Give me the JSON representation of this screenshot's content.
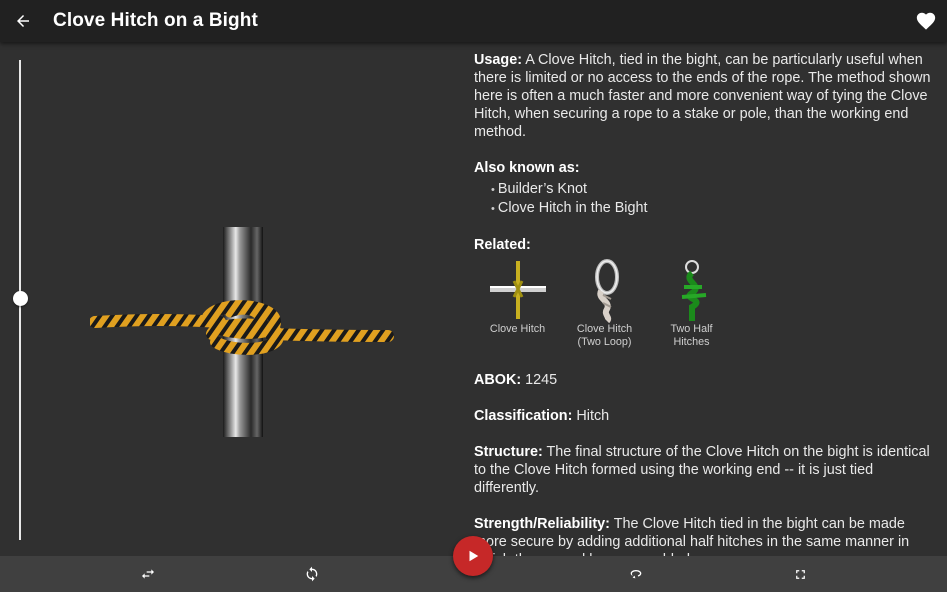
{
  "app_bar": {
    "title": "Clove Hitch on a Bight",
    "back_icon": "arrow-left-icon",
    "favorite_icon": "heart-icon"
  },
  "viewer": {
    "slider_position": 0.5,
    "rope_color": "#e0a020",
    "rope_pattern_color": "#1a1a1a"
  },
  "info": {
    "usage_label": "Usage:",
    "usage_text": "A Clove Hitch, tied in the bight, can be particularly useful when there is limited or no access to the ends of the rope. The method shown here is often a much faster and more convenient way of tying the Clove Hitch, when securing a rope to a stake or pole, than the working end method.",
    "aka_label": "Also known as:",
    "aka_items": [
      "Builder’s Knot",
      "Clove Hitch in the Bight"
    ],
    "related_label": "Related:",
    "related": [
      {
        "caption": "Clove Hitch",
        "icon": "clove-hitch-thumb"
      },
      {
        "caption": "Clove Hitch\n(Two Loop)",
        "icon": "clove-hitch-two-loop-thumb"
      },
      {
        "caption": "Two Half\nHitches",
        "icon": "two-half-hitches-thumb"
      }
    ],
    "abok_label": "ABOK:",
    "abok_value": "1245",
    "classification_label": "Classification:",
    "classification_value": "Hitch",
    "structure_label": "Structure:",
    "structure_text": "The final structure of the Clove Hitch on the bight is identical to the Clove Hitch formed using the working end -- it is just tied differently.",
    "strength_label": "Strength/Reliability:",
    "strength_text": "The Clove Hitch tied in the bight can be made more secure by adding additional half hitches in the same manner in which the second loop was added."
  },
  "bottom_bar": {
    "buttons": [
      "swap-icon",
      "rotate-icon",
      "loop-icon",
      "fullscreen-icon"
    ],
    "play_icon": "play-icon",
    "play_color": "#c62828"
  }
}
